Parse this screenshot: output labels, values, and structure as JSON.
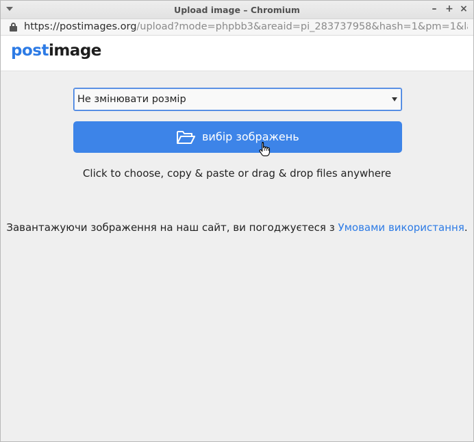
{
  "window": {
    "title": "Upload image – Chromium",
    "controls": {
      "minimize": "–",
      "maximize": "+",
      "close": "×"
    }
  },
  "addressbar": {
    "url_host": "https://postimages.org",
    "url_path": "/upload?mode=phpbb3&areaid=pi_283737958&hash=1&pm=1&lang=u..."
  },
  "site": {
    "logo_part1": "post",
    "logo_part2": "image",
    "brand_color": "#2d7be5"
  },
  "upload": {
    "resize_select_value": "Не змінювати розмір",
    "choose_button_label": "вибір зображень",
    "choose_button_color": "#3d84e8",
    "hint": "Click to choose, copy & paste or drag & drop files anywhere"
  },
  "terms": {
    "text": "Завантажуючи зображення на наш сайт, ви погоджуєтеся з ",
    "link": "Умовами використання",
    "end": "."
  },
  "icons": {
    "menu": "chevron-down-icon",
    "lock": "lock-icon",
    "folder": "folder-open-icon",
    "cursor": "hand-pointer-icon"
  }
}
